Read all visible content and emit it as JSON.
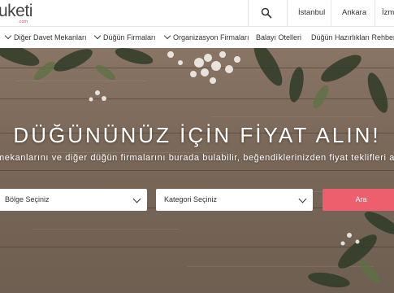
{
  "header": {
    "logo_text": "uketi",
    "logo_sub": ".com",
    "cities": [
      "İstanbul",
      "Ankara",
      "İzm"
    ]
  },
  "nav": {
    "items": [
      "Diğer Davet Mekanları",
      "Düğün Firmaları",
      "Organizasyon Firmaları",
      "Balayı Otelleri",
      "Düğün Hazırlıkları Rehberi"
    ]
  },
  "hero": {
    "title": "DÜĞÜNÜNÜZ İÇİN FİYAT ALIN!",
    "subtitle": "mekanlarını ve diğer düğün firmalarını burada bulabilir, beğendiklerinizden fiyat teklifleri alabi",
    "region_placeholder": "Bölge Seçiniz",
    "category_placeholder": "Kategori Seçiniz",
    "search_button": "Ara"
  },
  "colors": {
    "accent": "#ee5f6d",
    "logo_accent": "#e0475a"
  },
  "icons": {
    "search": "search-icon",
    "dropdown": "chevron-down-icon"
  }
}
